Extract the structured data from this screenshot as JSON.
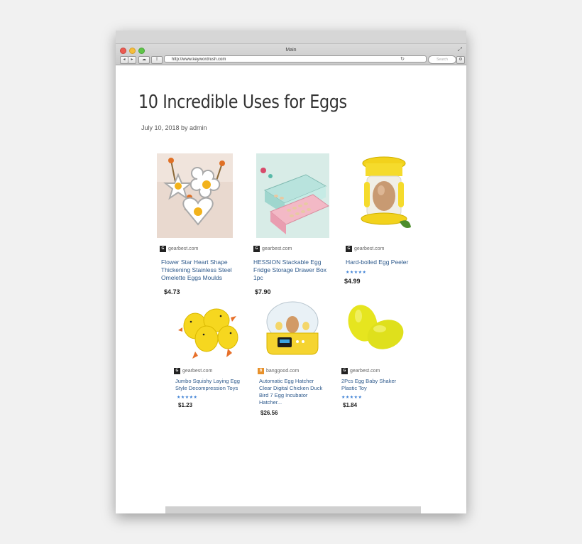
{
  "browser": {
    "title": "Main",
    "url": "http://www.keywordrush.com",
    "search_placeholder": "Search"
  },
  "post": {
    "title": "10 Incredible Uses for Eggs",
    "meta": "July 10, 2018 by admin"
  },
  "products": [
    {
      "store": "gearbest.com",
      "name_lines": [
        "Flower Star Heart Shape",
        "Thickening Stainless Steel",
        "Omelette Eggs Moulds"
      ],
      "price": "$4.73",
      "stars": ""
    },
    {
      "store": "gearbest.com",
      "name_lines": [
        "HESSION Stackable Egg",
        "Fridge Storage Drawer Box",
        "1pc"
      ],
      "price": "$7.90",
      "stars": ""
    },
    {
      "store": "gearbest.com",
      "name_lines": [
        "Hard-boiled Egg Peeler"
      ],
      "price": "$4.99",
      "stars": "★★★★★"
    },
    {
      "store": "gearbest.com",
      "name_lines": [
        "Jumbo Squishy Laying Egg",
        "Style Decompression Toys"
      ],
      "price": "$1.23",
      "stars": "★★★★★"
    },
    {
      "store": "banggood.com",
      "name_lines": [
        "Automatic Egg Hatcher",
        "Clear Digital Chicken Duck",
        "Bird 7 Egg Incubator",
        "Hatcher..."
      ],
      "price": "$26.56",
      "stars": ""
    },
    {
      "store": "gearbest.com",
      "name_lines": [
        "2Pcs Egg Baby Shaker",
        "Plastic Toy"
      ],
      "price": "$1.84",
      "stars": "★★★★★"
    }
  ]
}
